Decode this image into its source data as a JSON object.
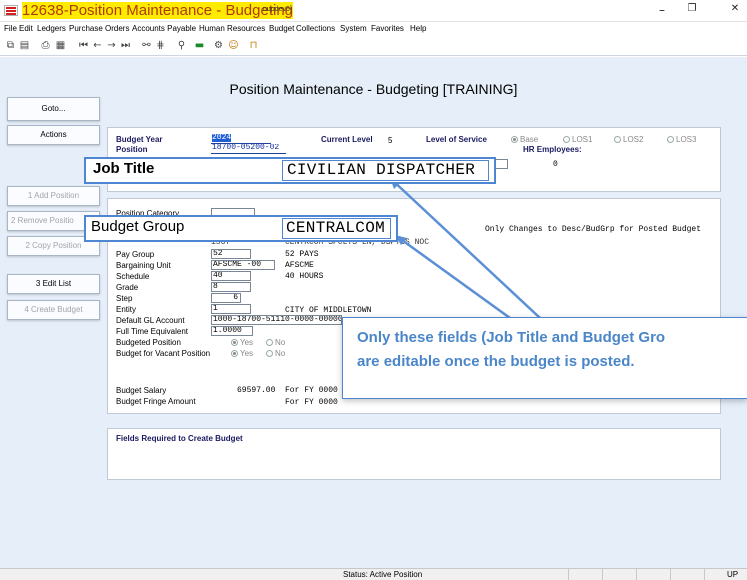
{
  "window": {
    "title": "12638-Position Maintenance - Budgeting",
    "title_suffix": "nupdev5]",
    "controls": {
      "minimize": "–",
      "restore": "❐",
      "close": "✕"
    }
  },
  "menu": [
    "File",
    "Edit",
    "Ledgers",
    "Purchase Orders",
    "Accounts Payable",
    "Human Resources",
    "Budget",
    "Collections",
    "System",
    "Favorites",
    "Help"
  ],
  "toolbar_icons": [
    "copy-icon",
    "paste-icon",
    "print-icon",
    "print-preview-icon",
    "first-record-icon",
    "previous-record-icon",
    "next-record-icon",
    "last-record-icon",
    "binoculars-icon",
    "find-next-icon",
    "zoom-icon",
    "excel-icon",
    "settings-icon",
    "users-icon",
    "export-icon"
  ],
  "page_heading": "Position Maintenance - Budgeting [TRAINING]",
  "buttons": {
    "goto": "Goto...",
    "actions": "Actions",
    "add_position": "1 Add Position",
    "remove_position": "2 Remove Positio",
    "copy_position": "2 Copy Position",
    "edit_list": "3 Edit List",
    "create_budget": "4 Create Budget"
  },
  "header": {
    "budget_year_label": "Budget Year",
    "budget_year": "2024",
    "position_label": "Position",
    "position": "18700-05200-02",
    "current_level_label": "Current Level",
    "current_level": "5",
    "level_of_service_label": "Level of Service",
    "los_options": [
      "Base",
      "LOS1",
      "LOS2",
      "LOS3"
    ],
    "hr_employees_label": "HR Employees:",
    "hr_employees": "0"
  },
  "details": {
    "position_category_label": "Position Category",
    "partial_value": "1567",
    "partial_desc": "CENTRCOM  SPCLTS LN, DSPTGS NOC",
    "note": "Only Changes to Desc/BudGrp for Posted Budget",
    "pay_group_label": "Pay Group",
    "pay_group": "52",
    "pay_group_desc": "52 PAYS",
    "bargaining_unit_label": "Bargaining Unit",
    "bargaining_unit": "AFSCME  -00",
    "bargaining_unit_desc": "AFSCME",
    "schedule_label": "Schedule",
    "schedule": "40",
    "schedule_desc": "40 HOURS",
    "grade_label": "Grade",
    "grade": "8",
    "step_label": "Step",
    "step": "6",
    "entity_label": "Entity",
    "entity": "1",
    "entity_desc": "CITY OF MIDDLETOWN",
    "gl_account_label": "Default GL Account",
    "gl_account": "1000-18700-51110-0000-00000",
    "fte_label": "Full Time Equivalent",
    "fte": "1.0000",
    "budgeted_position_label": "Budgeted Position",
    "budget_vacant_label": "Budget for Vacant Position",
    "yes_no": [
      "Yes",
      "No"
    ],
    "budget_salary_label": "Budget Salary",
    "budget_salary": "69597.00",
    "budget_salary_fy": "For FY 0000",
    "budget_fringe_label": "Budget Fringe Amount",
    "budget_fringe_fy": "For FY 0000"
  },
  "required_panel": {
    "title": "Fields Required to Create Budget"
  },
  "overlays": {
    "job_title_label": "Job Title",
    "job_title_value": "CIVILIAN DISPATCHER",
    "budget_group_label": "Budget Group",
    "budget_group_value": "CENTRALCOM",
    "callout_line1": "Only these fields (Job Title and Budget Gro",
    "callout_line2": "are editable once the budget is posted."
  },
  "status": {
    "text": "Status: Active Position",
    "mode": "UP"
  },
  "colors": {
    "title_accent": "#b03a00",
    "title_highlight": "#ffeb00",
    "background": "#e5eef9",
    "callout_border": "#4f86d4",
    "callout_text": "#4a86c8"
  }
}
